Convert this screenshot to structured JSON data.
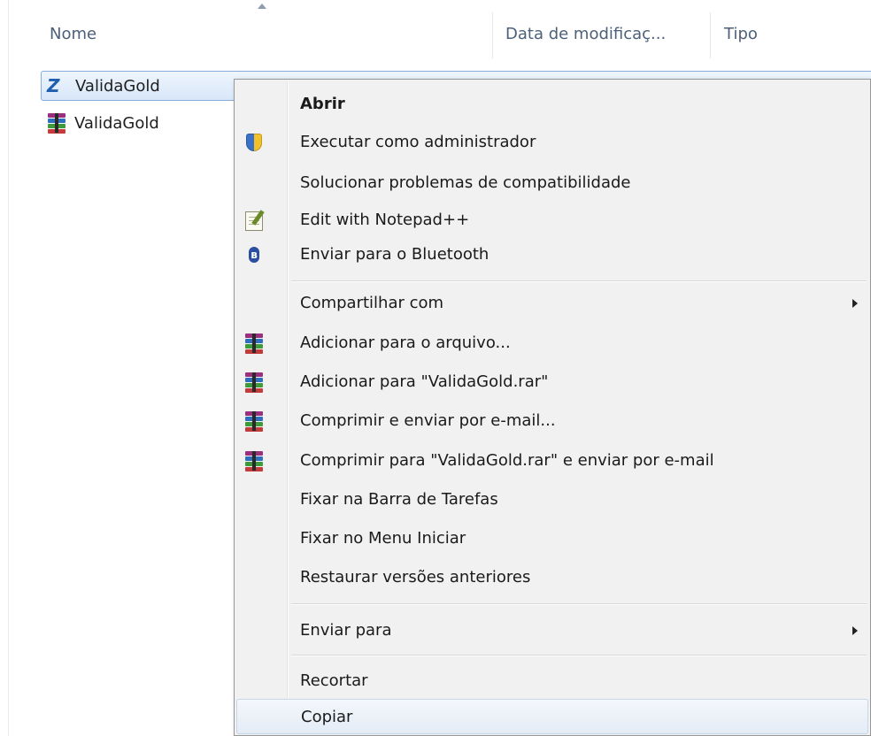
{
  "columns": {
    "name": "Nome",
    "date": "Data de modificaç...",
    "type": "Tipo"
  },
  "files": [
    {
      "name": "ValidaGold",
      "icon": "zend-app-icon",
      "selected": true
    },
    {
      "name": "ValidaGold",
      "icon": "winrar-archive-icon",
      "selected": false
    }
  ],
  "context_menu": {
    "items": [
      {
        "label": "Abrir",
        "icon": "",
        "bold": true
      },
      {
        "label": "Executar como administrador",
        "icon": "uac-shield-icon"
      },
      {
        "label": "Solucionar problemas de compatibilidade",
        "icon": ""
      },
      {
        "label": "Edit with Notepad++",
        "icon": "notepad-plus-plus-icon"
      },
      {
        "label": "Enviar para o Bluetooth",
        "icon": "bluetooth-icon"
      },
      {
        "label": "Compartilhar com",
        "icon": "",
        "submenu": true
      },
      {
        "label": "Adicionar para o arquivo...",
        "icon": "winrar-icon"
      },
      {
        "label": "Adicionar para \"ValidaGold.rar\"",
        "icon": "winrar-icon"
      },
      {
        "label": "Comprimir e enviar por e-mail...",
        "icon": "winrar-icon"
      },
      {
        "label": "Comprimir para \"ValidaGold.rar\" e enviar por e-mail",
        "icon": "winrar-icon"
      },
      {
        "label": "Fixar na Barra de Tarefas",
        "icon": ""
      },
      {
        "label": "Fixar no Menu Iniciar",
        "icon": ""
      },
      {
        "label": "Restaurar versões anteriores",
        "icon": ""
      },
      {
        "label": "Enviar para",
        "icon": "",
        "submenu": true
      },
      {
        "label": "Recortar",
        "icon": ""
      },
      {
        "label": "Copiar",
        "icon": "",
        "highlighted": true
      }
    ]
  },
  "colors": {
    "selection_border": "#84acdd",
    "menu_background": "#f1f1f1",
    "header_text": "#4c607a"
  }
}
